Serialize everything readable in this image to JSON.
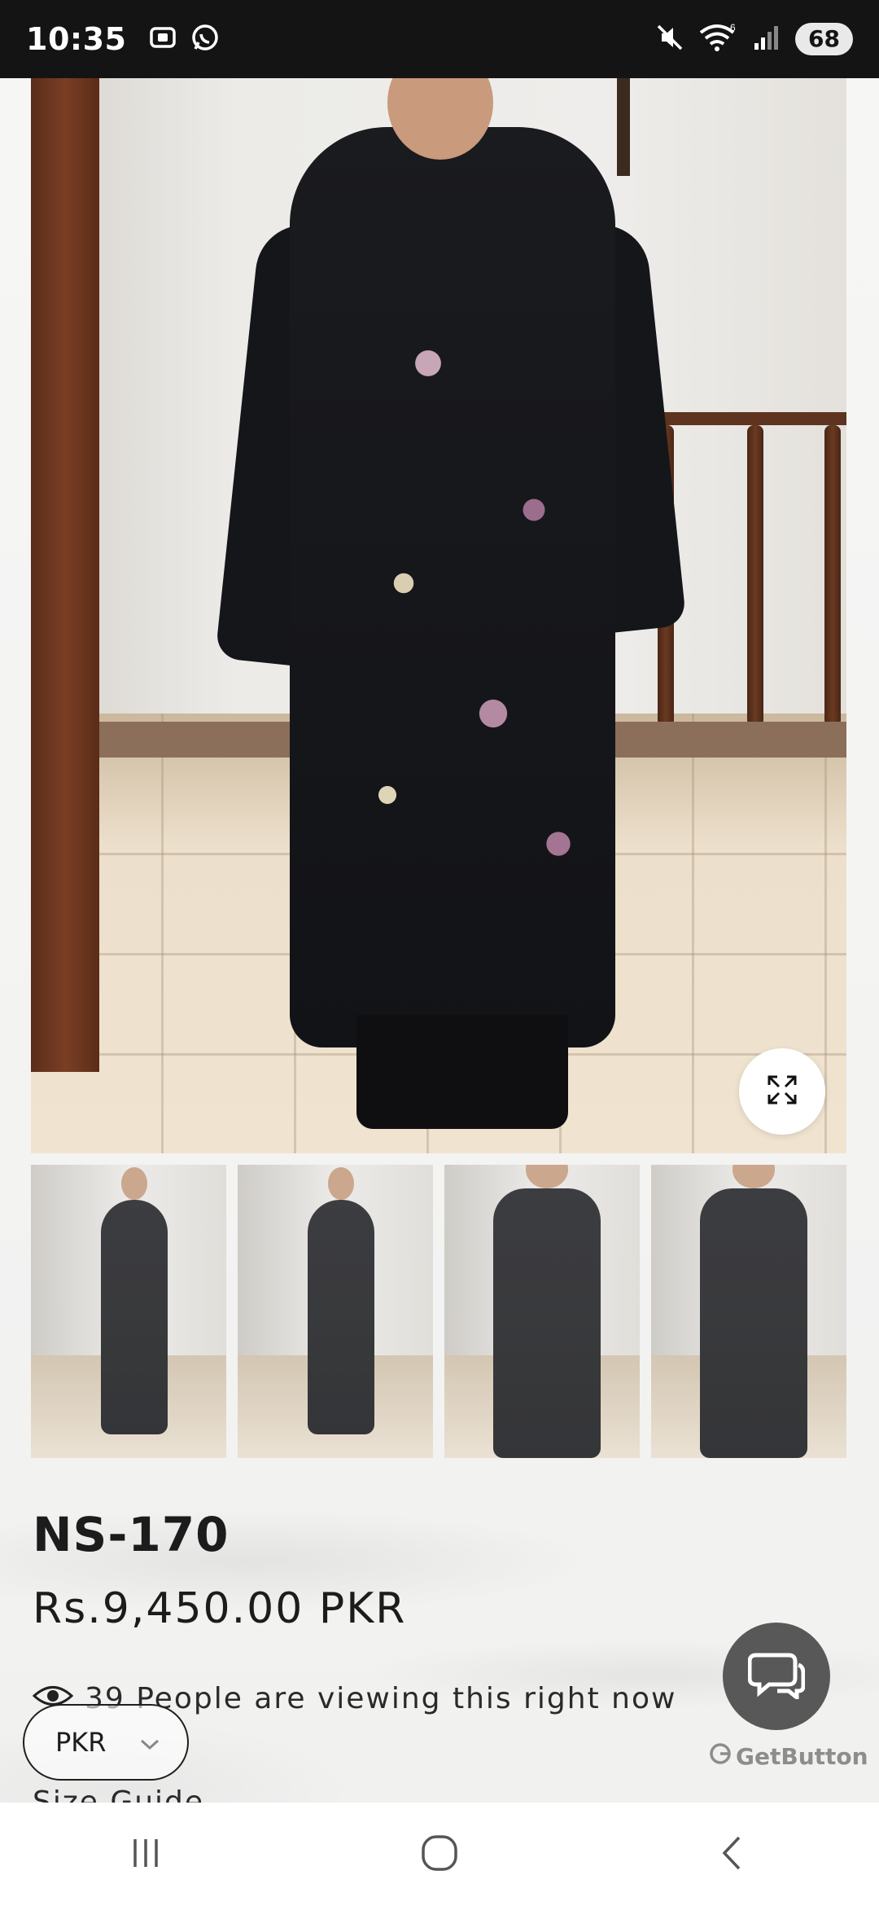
{
  "status_bar": {
    "time": "10:35",
    "battery": "68",
    "network_badge": "6"
  },
  "product": {
    "title": "NS-170",
    "price": "Rs.9,450.00 PKR",
    "viewing_text": "39 People are viewing this right now",
    "size_guide": "Size Guide"
  },
  "gallery": {
    "thumbnail_count": 4
  },
  "currency_selector": {
    "selected": "PKR"
  },
  "chat_widget": {
    "brand": "GetButton"
  },
  "colors": {
    "status_bar_bg": "#141414",
    "chat_button": "#585858",
    "text": "#1c1c1c"
  }
}
